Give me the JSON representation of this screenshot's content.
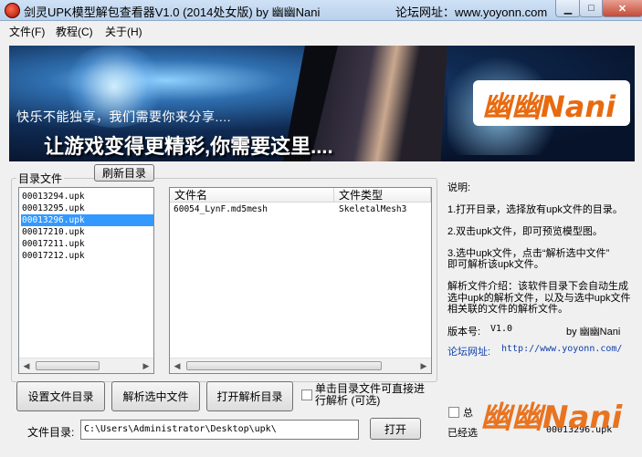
{
  "window": {
    "title": "剑灵UPK模型解包查看器V1.0 (2014处女版)   by 幽幽Nani",
    "forum_caption": "论坛网址：www.yoyonn.com"
  },
  "menu": [
    "文件(F)",
    "教程(C)",
    "关于(H)"
  ],
  "banner": {
    "line1": "快乐不能独享，我们需要你来分享....",
    "line2": "让游戏变得更精彩,你需要这里....",
    "logo": "幽幽Nani"
  },
  "filelist": {
    "group_label": "目录文件",
    "refresh_label": "刷新目录",
    "items": [
      "00013294.upk",
      "00013295.upk",
      "00013296.upk",
      "00017210.upk",
      "00017211.upk",
      "00017212.upk"
    ],
    "selected_index": 2
  },
  "mesh_table": {
    "columns": [
      "文件名",
      "文件类型"
    ],
    "rows": [
      [
        "60054_LynF.md5mesh",
        "SkeletalMesh3"
      ]
    ]
  },
  "buttons": {
    "set_dir": "设置文件目录",
    "parse": "解析选中文件",
    "open_parse_dir": "打开解析目录",
    "open": "打开"
  },
  "direct_parse_label": "单击目录文件可直接进行解析 (可选)",
  "dir": {
    "label": "文件目录:",
    "value": "C:\\Users\\Administrator\\Desktop\\upk\\"
  },
  "info": {
    "title": "说明:",
    "step1": "1.打开目录，选择放有upk文件的目录。",
    "step2": "2.双击upk文件，即可预览模型图。",
    "step3a": "3.选中upk文件，点击“解析选中文件”",
    "step3b": "即可解析该upk文件。",
    "parse_intro_a": "解析文件介绍：该软件目录下会自动生成",
    "parse_intro_b": "选中upk的解析文件，以及与选中upk文件",
    "parse_intro_c": "相关联的文件的解析文件。",
    "version_label": "版本号:",
    "version": "V1.0",
    "by": "by 幽幽Nani",
    "forum_label": "论坛网址:",
    "forum_url": "http://www.yoyonn.com/"
  },
  "status": {
    "total_checkbox": "总",
    "selected_label": "已经选",
    "selected_file": "00013296.upk"
  }
}
